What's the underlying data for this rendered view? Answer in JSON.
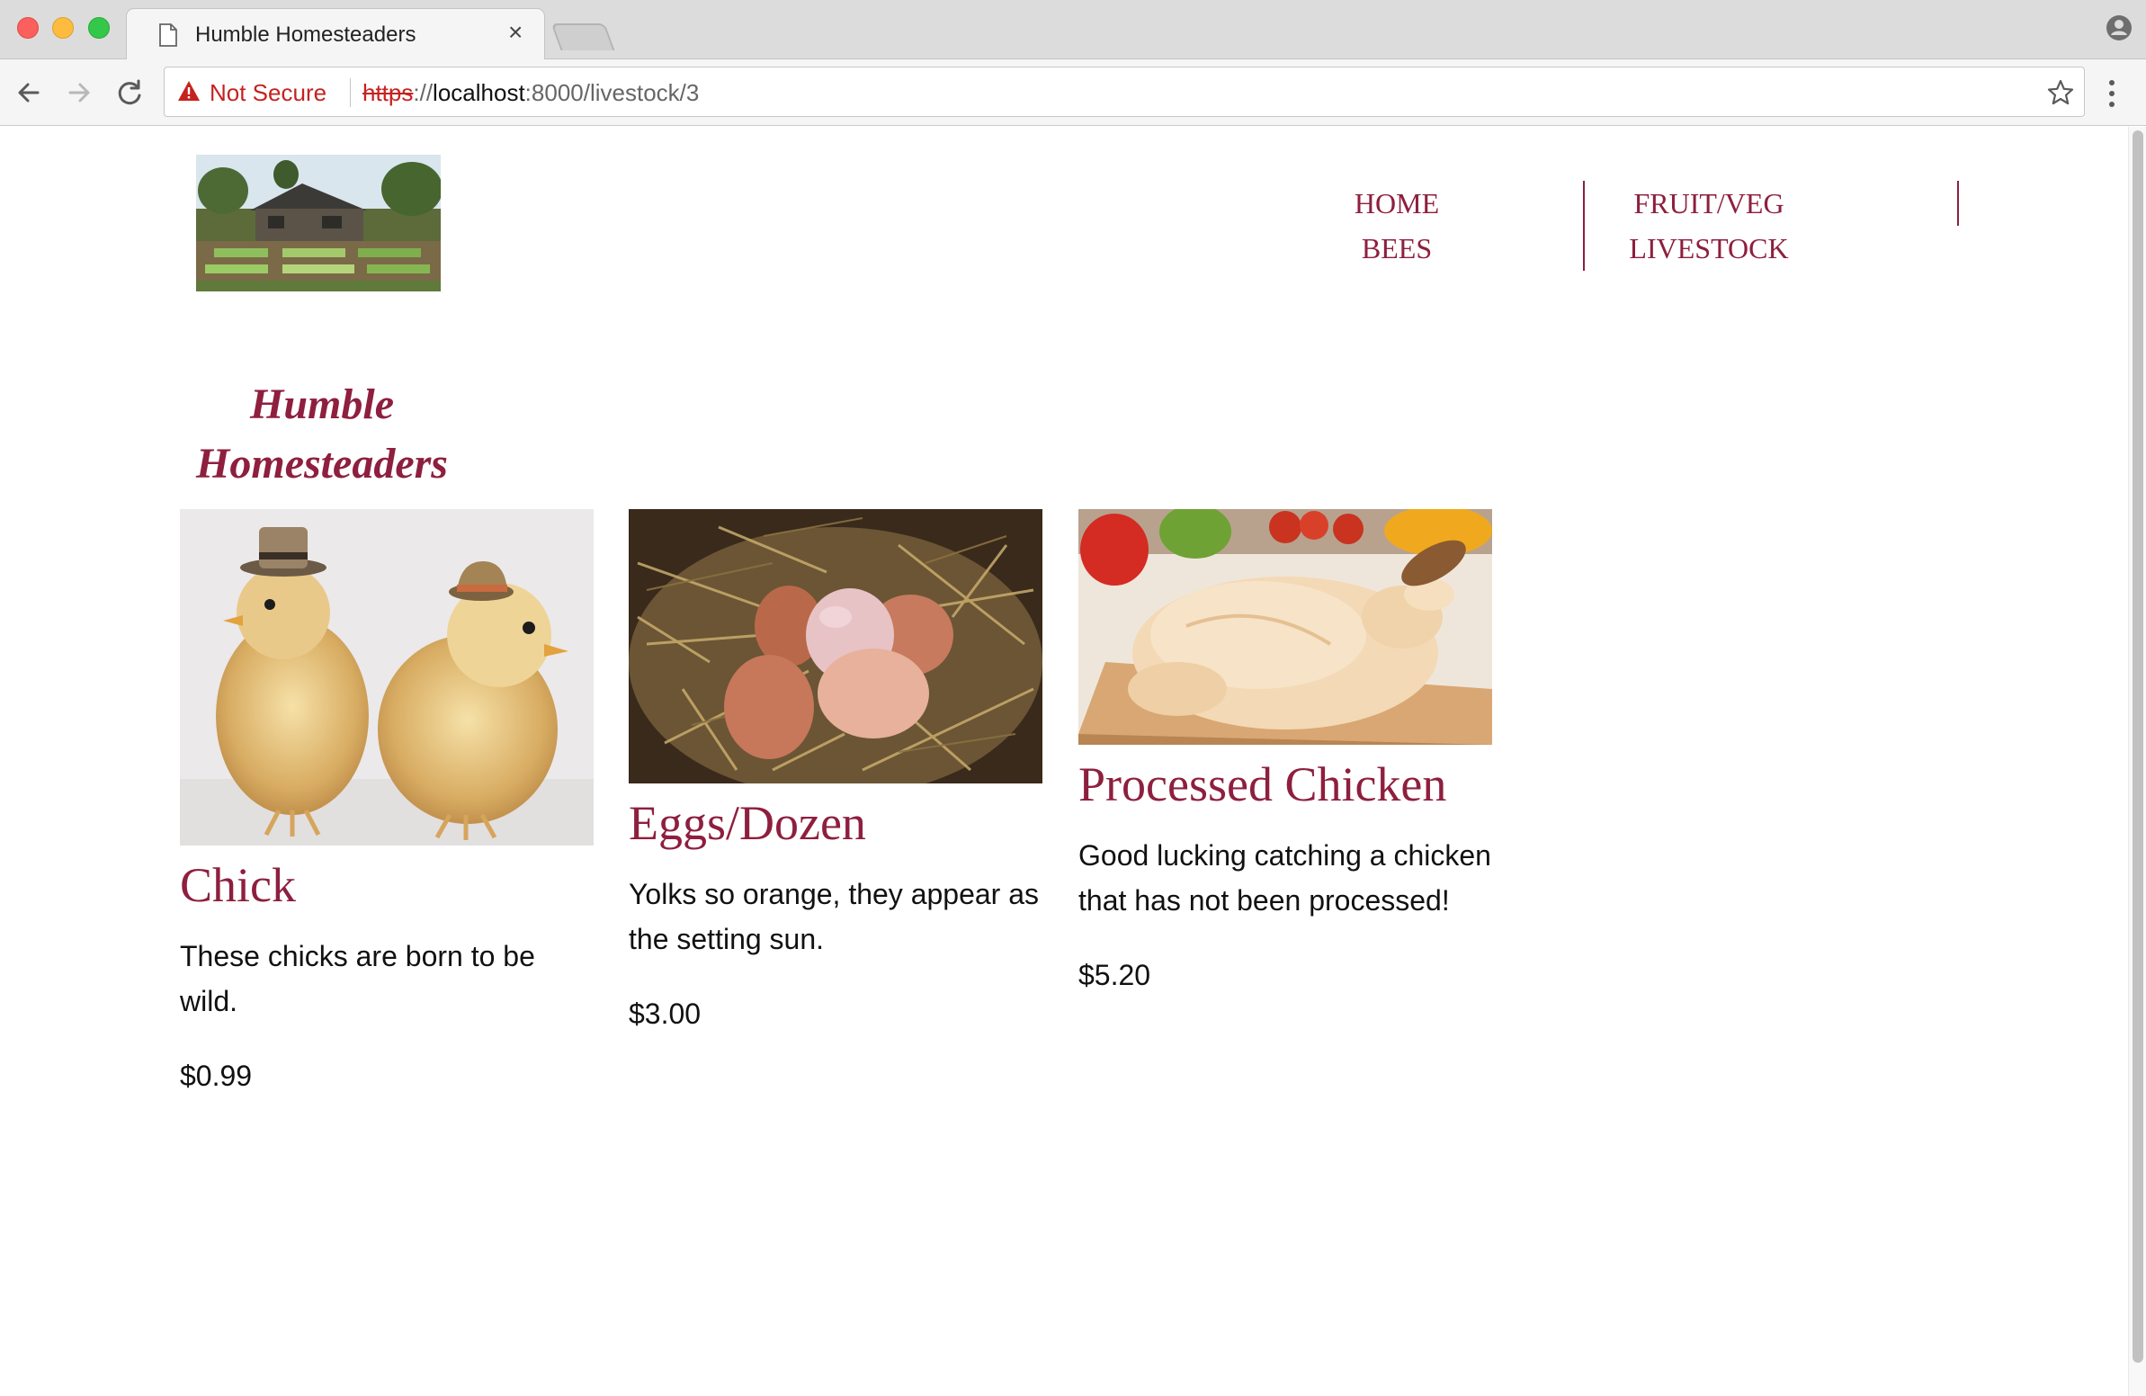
{
  "browser": {
    "tab_title": "Humble Homesteaders",
    "tab_close": "×",
    "security_label": "Not Secure",
    "url_scheme": "https",
    "url_sep": "://",
    "url_host": "localhost",
    "url_rest": ":8000/livestock/3"
  },
  "site": {
    "title_line1": "Humble",
    "title_line2": "Homesteaders",
    "logo_alt": "Homestead farm house with vegetable garden"
  },
  "nav": {
    "home": "HOME",
    "bees": "BEES",
    "fruit_veg": "FRUIT/VEG",
    "livestock": "LIVESTOCK"
  },
  "products": [
    {
      "name": "Chick",
      "description": "These chicks are born to be wild.",
      "price": "$0.99",
      "image": "two chicks wearing hats"
    },
    {
      "name": "Eggs/Dozen",
      "description": "Yolks so orange, they appear as the setting sun.",
      "price": "$3.00",
      "image": "brown eggs in a straw nest"
    },
    {
      "name": "Processed Chicken",
      "description": "Good lucking catching a chicken that has not been processed!",
      "price": "$5.20",
      "image": "raw whole chicken on a cutting board"
    }
  ],
  "colors": {
    "brand": "#8e1f3e",
    "warning": "#c5221f"
  }
}
